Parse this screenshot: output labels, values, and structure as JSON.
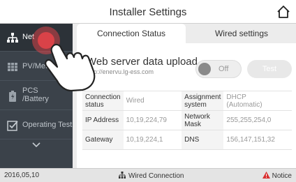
{
  "header": {
    "title": "Installer Settings",
    "home_icon": "home-icon"
  },
  "sidebar": {
    "items": [
      {
        "label": "Net",
        "icon": "network-icon"
      },
      {
        "label": "PV/Meter",
        "icon": "grid-icon"
      },
      {
        "label_line1": "PCS",
        "label_line2": "/Battery",
        "icon": "battery-icon"
      },
      {
        "label": "Operating Test",
        "icon": "checkbox-icon"
      }
    ],
    "more_icon": "chevron-down-icon"
  },
  "tabs": [
    {
      "label": "Connection Status"
    },
    {
      "label": "Wired settings"
    }
  ],
  "upload": {
    "label": "Web server data upload",
    "url": "http://enervu.lg-ess.com",
    "toggle_text": "Off",
    "test_label": "Test"
  },
  "table": {
    "rows": [
      {
        "k1_line1": "Connection",
        "k1_line2": "status",
        "v1": "Wired",
        "k2_line1": "Assignment",
        "k2_line2": "system",
        "v2_line1": "DHCP",
        "v2_line2": "(Automatic)"
      },
      {
        "k1": "IP Address",
        "v1": "10,19,224,79",
        "k2": "Network Mask",
        "v2": "255,255,254,0"
      },
      {
        "k1": "Gateway",
        "v1": "10,19,224,1",
        "k2": "DNS",
        "v2": "156,147,151,32"
      }
    ]
  },
  "footer": {
    "date": "2016,05,10",
    "connection": "Wired Connection",
    "notice": "Notice"
  },
  "colors": {
    "sidebar": "#3b424a",
    "active_touch": "#e8444a",
    "notice_icon": "#d93030"
  }
}
